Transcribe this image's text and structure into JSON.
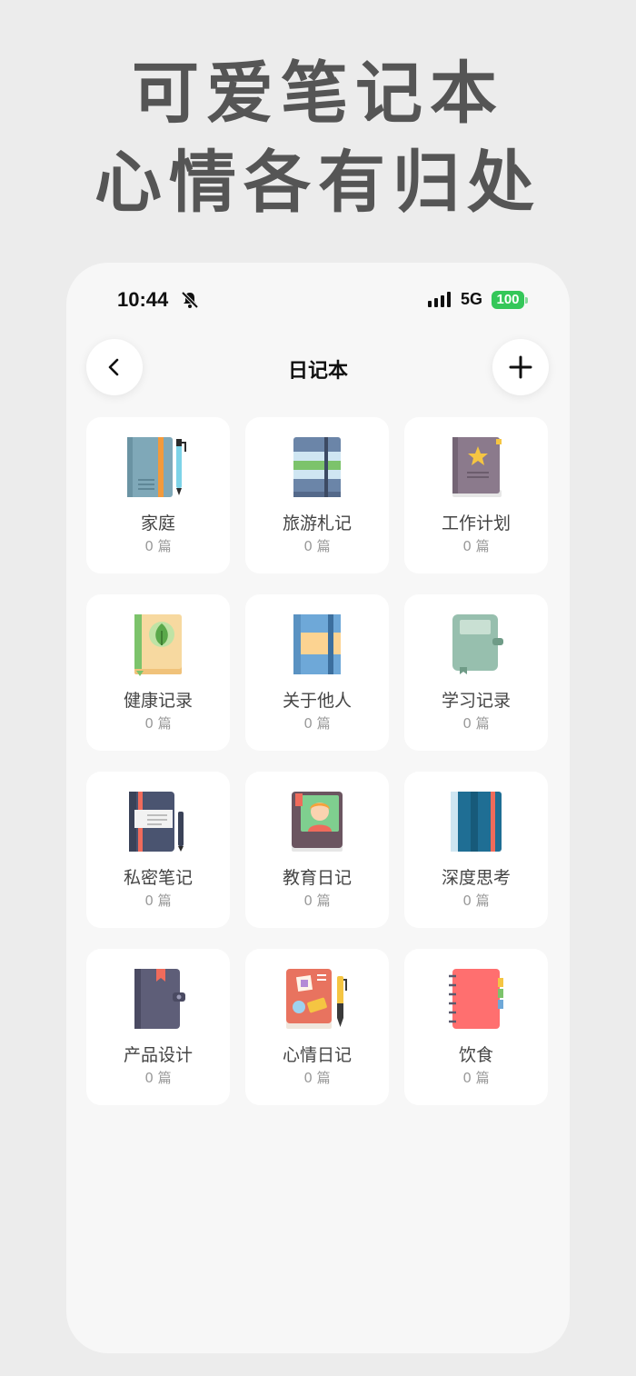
{
  "headline": {
    "line1": "可爱笔记本",
    "line2": "心情各有归处"
  },
  "status_bar": {
    "time": "10:44",
    "network": "5G",
    "battery": "100"
  },
  "nav": {
    "title": "日记本"
  },
  "notebooks": [
    {
      "name": "家庭",
      "count": "0 篇",
      "icon": "teal-notebook-with-pen-icon"
    },
    {
      "name": "旅游札记",
      "count": "0 篇",
      "icon": "blue-green-notebook-icon"
    },
    {
      "name": "工作计划",
      "count": "0 篇",
      "icon": "star-notebook-icon"
    },
    {
      "name": "健康记录",
      "count": "0 篇",
      "icon": "leaf-book-icon"
    },
    {
      "name": "关于他人",
      "count": "0 篇",
      "icon": "striped-notebook-icon"
    },
    {
      "name": "学习记录",
      "count": "0 篇",
      "icon": "sage-notebook-icon"
    },
    {
      "name": "私密笔记",
      "count": "0 篇",
      "icon": "dark-notebook-with-pen-icon"
    },
    {
      "name": "教育日记",
      "count": "0 篇",
      "icon": "portrait-book-icon"
    },
    {
      "name": "深度思考",
      "count": "0 篇",
      "icon": "blue-striped-notebook-icon"
    },
    {
      "name": "产品设计",
      "count": "0 篇",
      "icon": "planner-notebook-icon"
    },
    {
      "name": "心情日记",
      "count": "0 篇",
      "icon": "sticker-notebook-with-pen-icon"
    },
    {
      "name": "饮食",
      "count": "0 篇",
      "icon": "spiral-notebook-icon"
    }
  ],
  "colors": {
    "background": "#ececec",
    "phone": "#f7f7f7",
    "card": "#ffffff",
    "battery": "#34c759",
    "headline": "#555555"
  }
}
